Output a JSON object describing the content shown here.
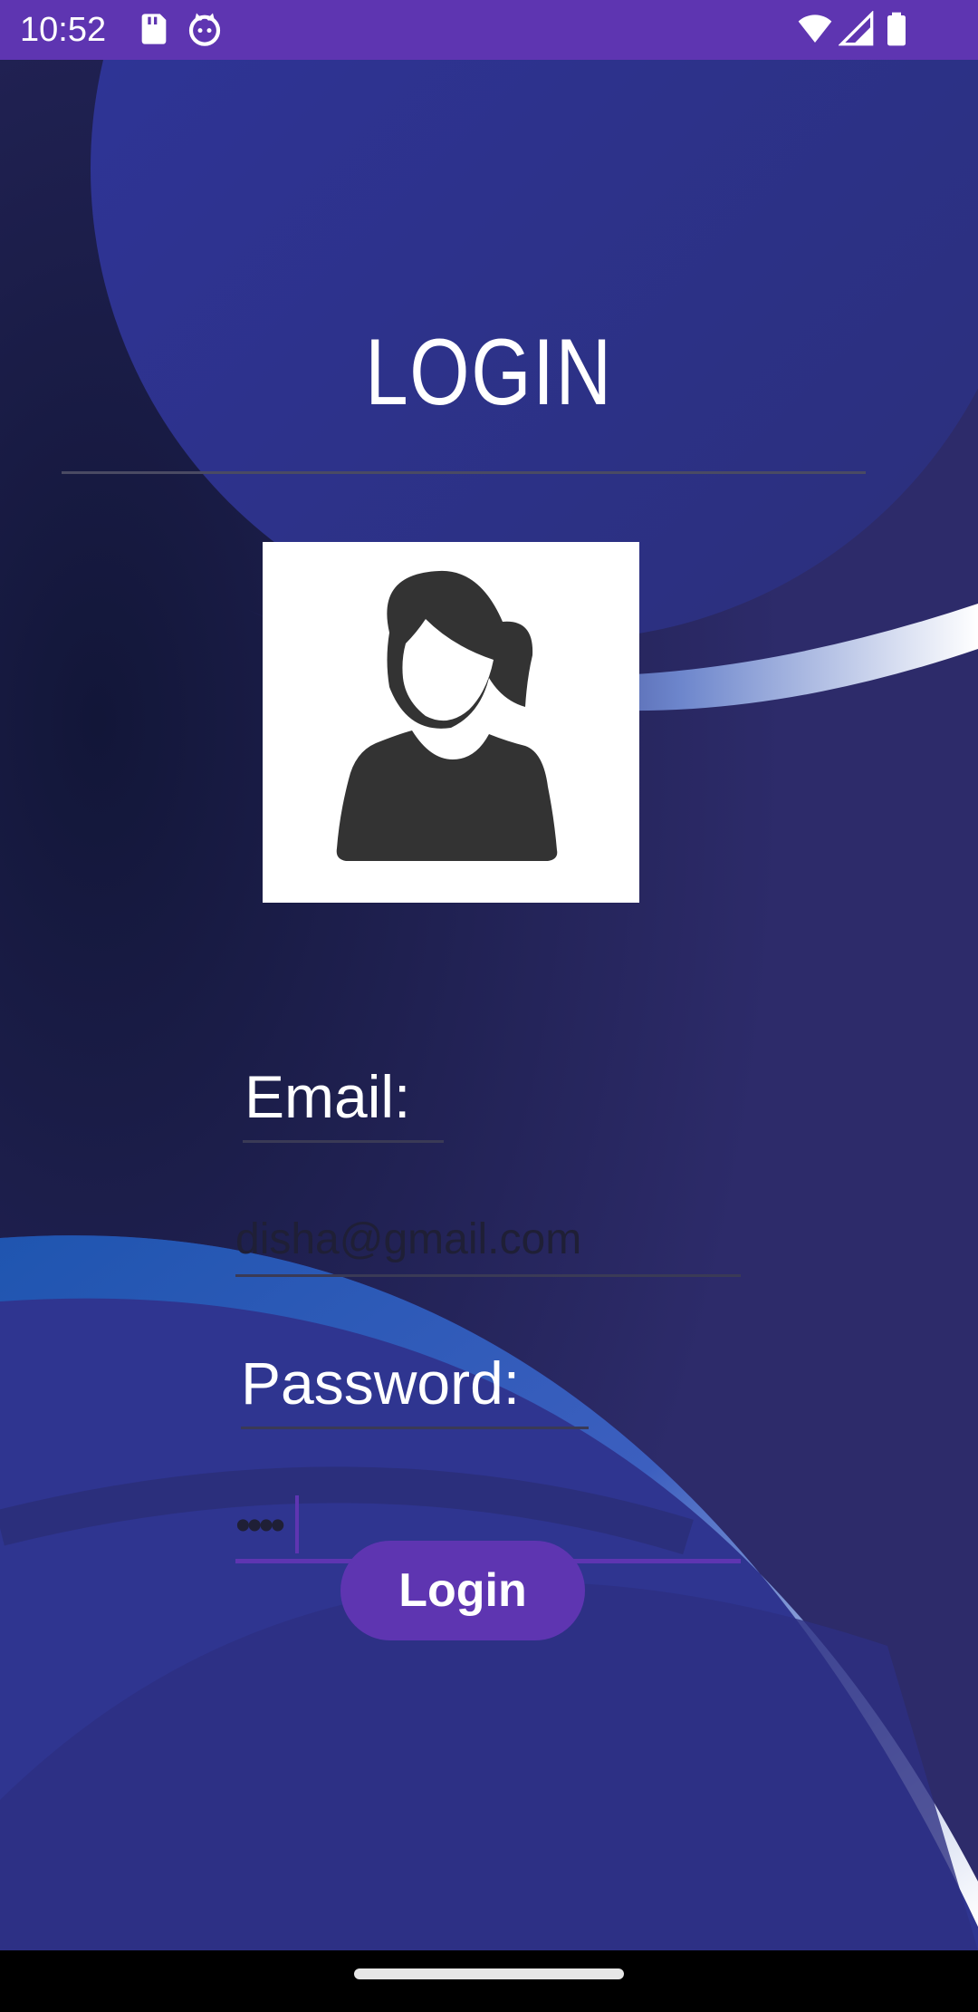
{
  "status_bar": {
    "time": "10:52",
    "background": "#5e35b1",
    "left_icons": [
      "sd-card-icon",
      "cat-icon"
    ],
    "right_icons": [
      "wifi-icon",
      "signal-icon",
      "battery-icon"
    ]
  },
  "login": {
    "title": "LOGIN",
    "avatar_icon": "user-female-icon",
    "email_label": "Email:",
    "email_value": "disha@gmail.com",
    "password_label": "Password:",
    "password_value": "••••",
    "button_label": "Login"
  },
  "colors": {
    "accent": "#5e35b1",
    "background": "#2e3192",
    "text": "#ffffff"
  }
}
